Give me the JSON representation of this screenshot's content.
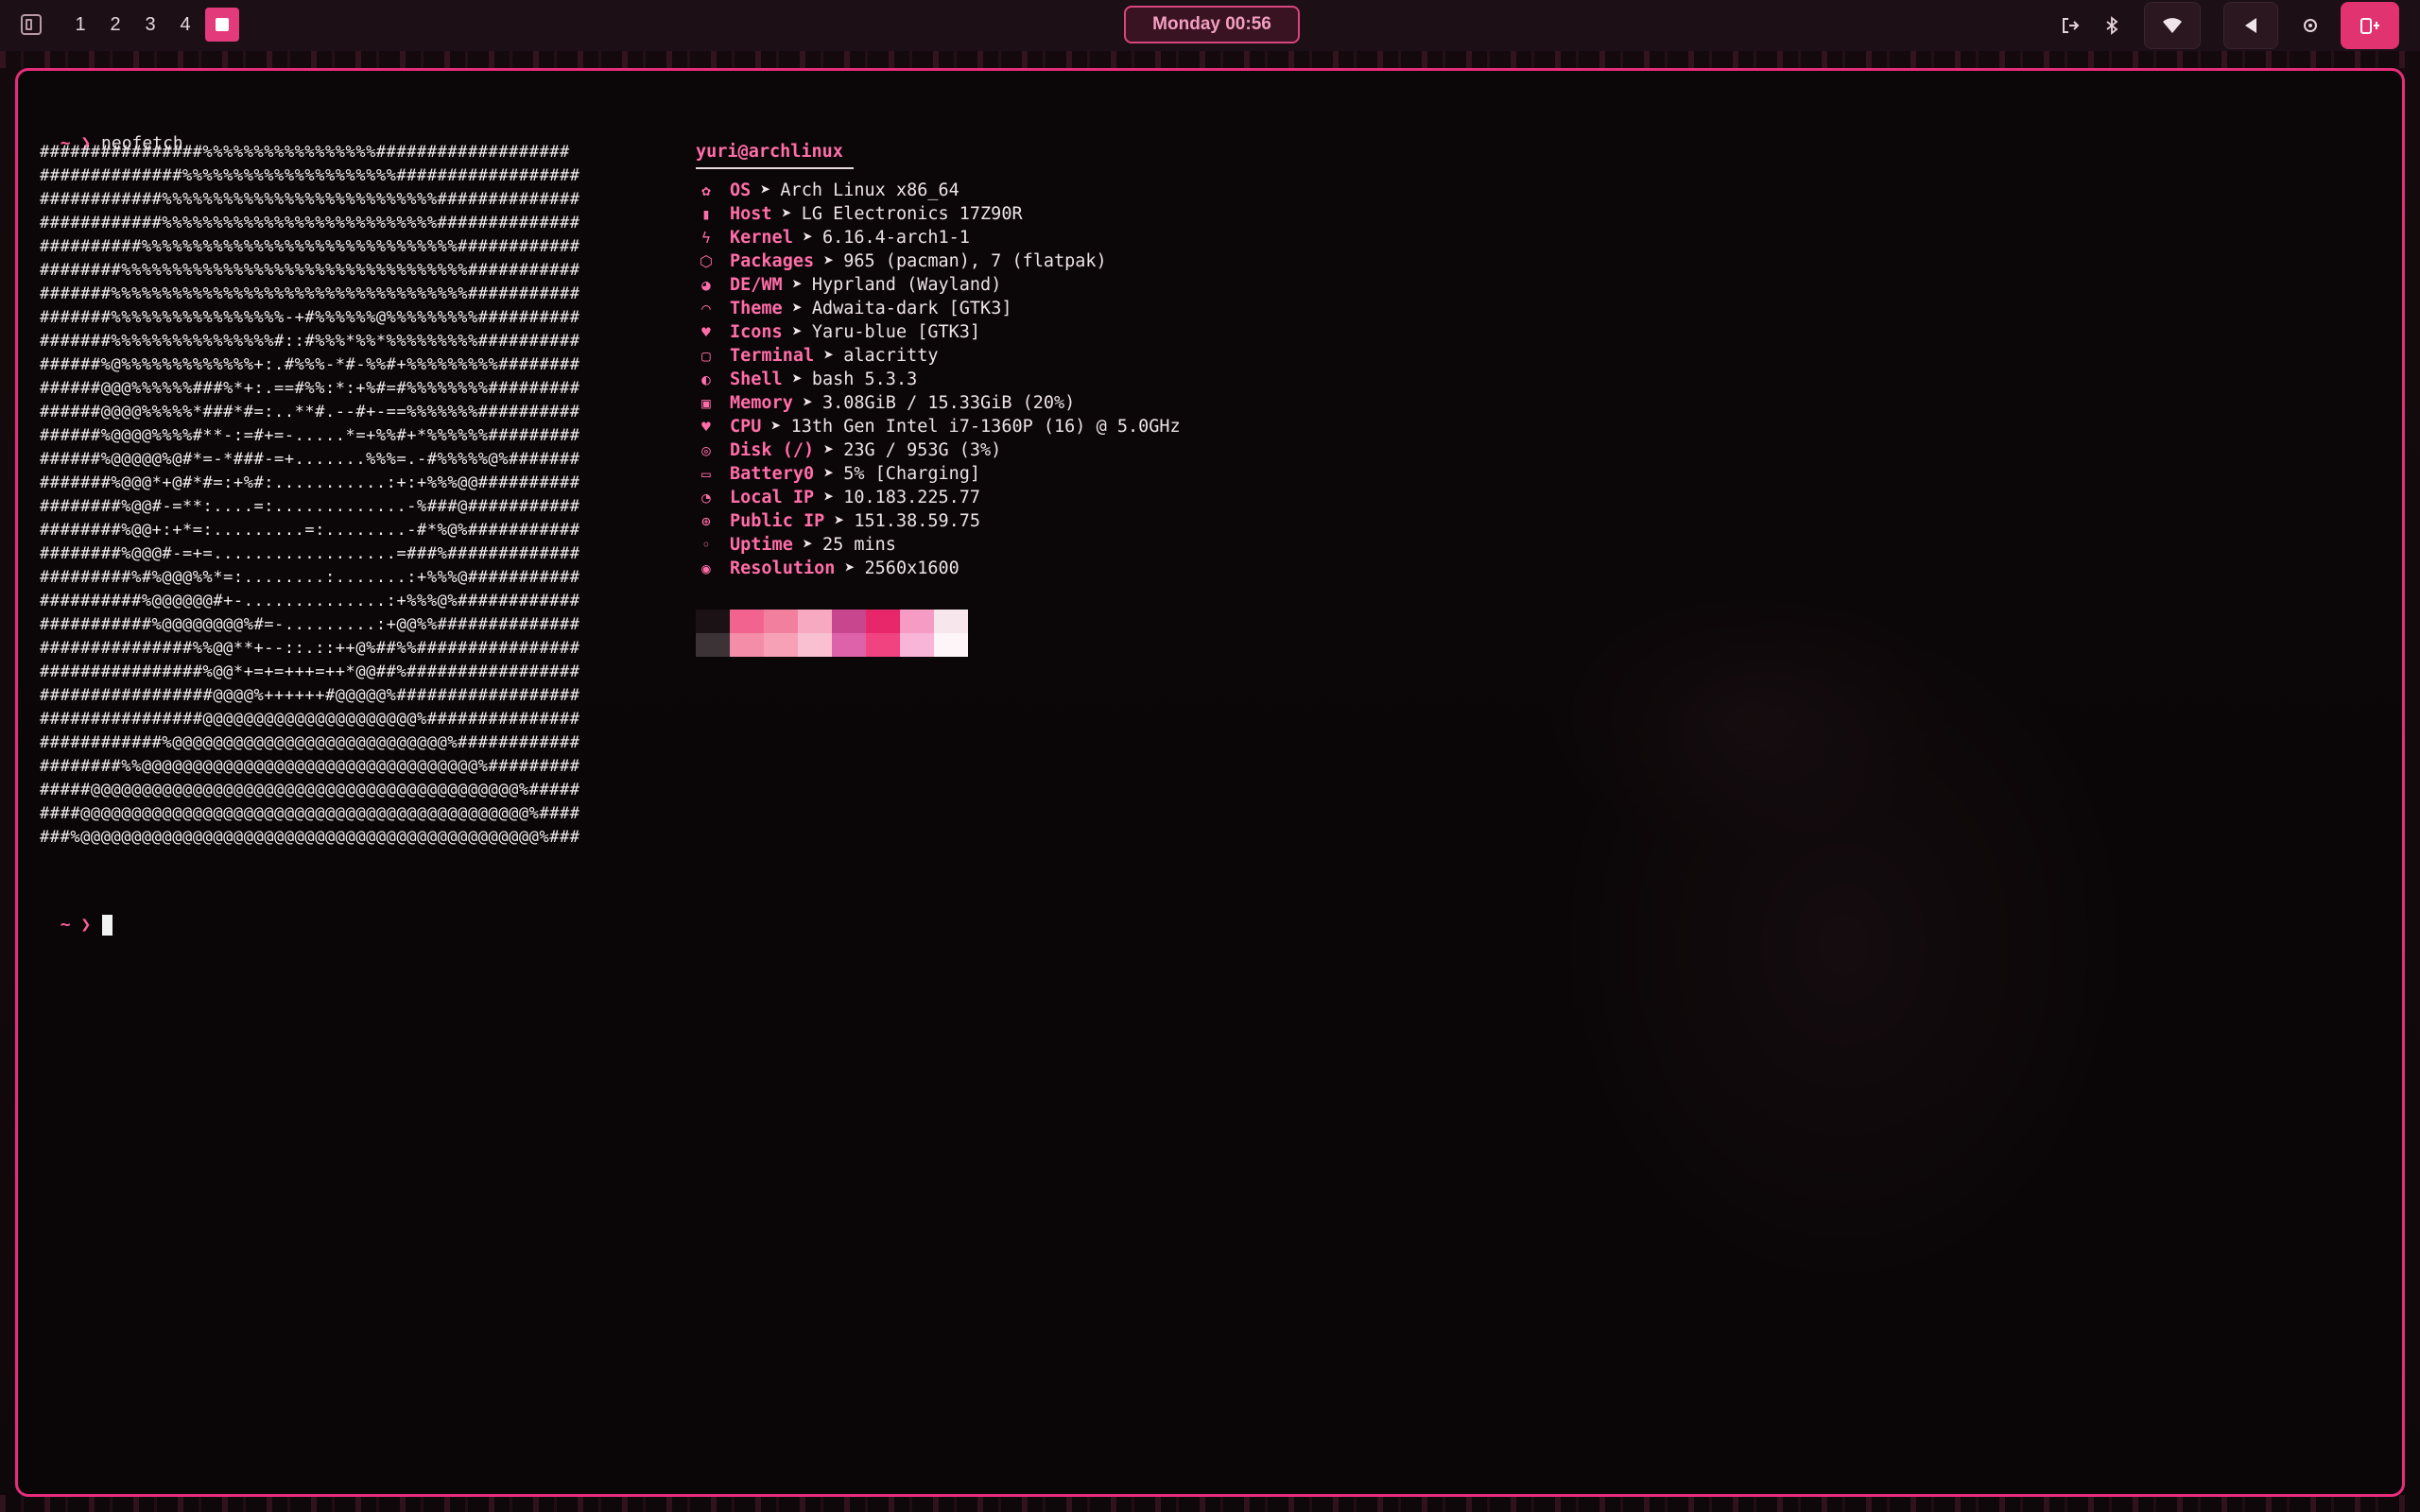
{
  "topbar": {
    "workspaces": [
      "1",
      "2",
      "3",
      "4"
    ],
    "clock": "Monday 00:56",
    "icons": [
      "launcher-icon",
      "logout-icon",
      "bluetooth-icon",
      "wifi-icon",
      "volume-icon",
      "brightness-icon",
      "power-icon"
    ]
  },
  "terminal": {
    "prompt_symbol": "~ ❯",
    "command": "neofetch",
    "ascii_art": [
      "################%%%%%%%%%%%%%%%%%###################",
      "##############%%%%%%%%%%%%%%%%%%%%%##################",
      "############%%%%%%%%%%%%%%%%%%%%%%%%%%%##############",
      "############%%%%%%%%%%%%%%%%%%%%%%%%%%%##############",
      "##########%%%%%%%%%%%%%%%%%%%%%%%%%%%%%%%############",
      "########%%%%%%%%%%%%%%%%%%%%%%%%%%%%%%%%%%###########",
      "#######%%%%%%%%%%%%%%%%%%%%%%%%%%%%%%%%%%%###########",
      "#######%%%%%%%%%%%%%%%%%-+#%%%%%%@%%%%%%%%%##########",
      "#######%%%%%%%%%%%%%%%%#::#%%%*%%*%%%%%%%%%##########",
      "######%@%%%%%%%%%%%%%+:.#%%%-*#-%%#+%%%%%%%%%########",
      "######@@@%%%%%%###%*+:.==#%%:*:+%#=#%%%%%%%%#########",
      "######@@@@%%%%%*###*#=:..**#.--#+-==%%%%%%%##########",
      "######%@@@@%%%%#**-:=#+=-.....*=+%%#+*%%%%%%#########",
      "######%@@@@@%@#*=-*###-=+.......%%%=.-#%%%%%@%#######",
      "#######%@@@*+@#*#=:+%#:...........:+:+%%%@@##########",
      "########%@@#-=**:....=:.............-%###@###########",
      "########%@@+:+*=:.........=:........-#*%@%###########",
      "########%@@@#-=+=..................=###%#############",
      "#########%#%@@@%%*=:........:.......:+%%%@###########",
      "##########%@@@@@@#+-..............:+%%%@%############",
      "###########%@@@@@@@@%#=-.........:+@@%%##############",
      "###############%%@@**+--::.::++@%##%%################",
      "################%@@*+=+=+++=++*@@##%#################",
      "#################@@@@%++++++#@@@@@%##################",
      "################@@@@@@@@@@@@@@@@@@@@@%###############",
      "############%@@@@@@@@@@@@@@@@@@@@@@@@@@@%############",
      "########%%@@@@@@@@@@@@@@@@@@@@@@@@@@@@@@@@@%#########",
      "#####@@@@@@@@@@@@@@@@@@@@@@@@@@@@@@@@@@@@@@@@@@%#####",
      "####@@@@@@@@@@@@@@@@@@@@@@@@@@@@@@@@@@@@@@@@@@@@%####",
      "###%@@@@@@@@@@@@@@@@@@@@@@@@@@@@@@@@@@@@@@@@@@@@@%###"
    ],
    "user_host": "yuri@archlinux",
    "info": [
      {
        "icon": "flower-icon",
        "glyph": "✿",
        "key": "OS",
        "value": "Arch Linux x86_64"
      },
      {
        "icon": "laptop-icon",
        "glyph": "▮",
        "key": "Host",
        "value": "LG Electronics 17Z90R"
      },
      {
        "icon": "bolt-icon",
        "glyph": "ϟ",
        "key": "Kernel",
        "value": "6.16.4-arch1-1"
      },
      {
        "icon": "package-icon",
        "glyph": "⬡",
        "key": "Packages",
        "value": "965 (pacman), 7 (flatpak)"
      },
      {
        "icon": "palette-icon",
        "glyph": "◕",
        "key": "DE/WM",
        "value": "Hyprland (Wayland)"
      },
      {
        "icon": "rainbow-icon",
        "glyph": "◠",
        "key": "Theme",
        "value": "Adwaita-dark [GTK3]"
      },
      {
        "icon": "heart-icon",
        "glyph": "♥",
        "key": "Icons",
        "value": "Yaru-blue [GTK3]"
      },
      {
        "icon": "terminal-icon",
        "glyph": "▢",
        "key": "Terminal",
        "value": "alacritty"
      },
      {
        "icon": "shell-icon",
        "glyph": "◐",
        "key": "Shell",
        "value": "bash 5.3.3"
      },
      {
        "icon": "memory-icon",
        "glyph": "▣",
        "key": "Memory",
        "value": "3.08GiB / 15.33GiB (20%)"
      },
      {
        "icon": "cpu-heart-icon",
        "glyph": "♥",
        "key": "CPU",
        "value": "13th Gen Intel i7-1360P (16) @ 5.0GHz"
      },
      {
        "icon": "disk-icon",
        "glyph": "◎",
        "key": "Disk (/)",
        "value": "23G / 953G (3%)"
      },
      {
        "icon": "battery-icon",
        "glyph": "▭",
        "key": "Battery0",
        "value": "5% [Charging]"
      },
      {
        "icon": "network-icon",
        "glyph": "◔",
        "key": "Local IP",
        "value": "10.183.225.77"
      },
      {
        "icon": "globe-icon",
        "glyph": "⊕",
        "key": "Public IP",
        "value": "151.38.59.75"
      },
      {
        "icon": "clock-icon",
        "glyph": "◦",
        "key": "Uptime",
        "value": "25 mins"
      },
      {
        "icon": "target-icon",
        "glyph": "◉",
        "key": "Resolution",
        "value": "2560x1600"
      }
    ],
    "arrow": "➤",
    "palette_top": [
      "#1a1214",
      "#f2648f",
      "#f27f9d",
      "#f7a9c2",
      "#c8468e",
      "#e8276a",
      "#f59bc4",
      "#f7e6ec"
    ],
    "palette_bottom": [
      "#3b3336",
      "#f38da8",
      "#f6a1b6",
      "#f9c0d2",
      "#dd62a9",
      "#f0437f",
      "#f9b5d8",
      "#fdf5f8"
    ]
  },
  "colors": {
    "accent": "#e52d7a",
    "accent_text": "#ff6ea8",
    "background": "#0d0709"
  }
}
